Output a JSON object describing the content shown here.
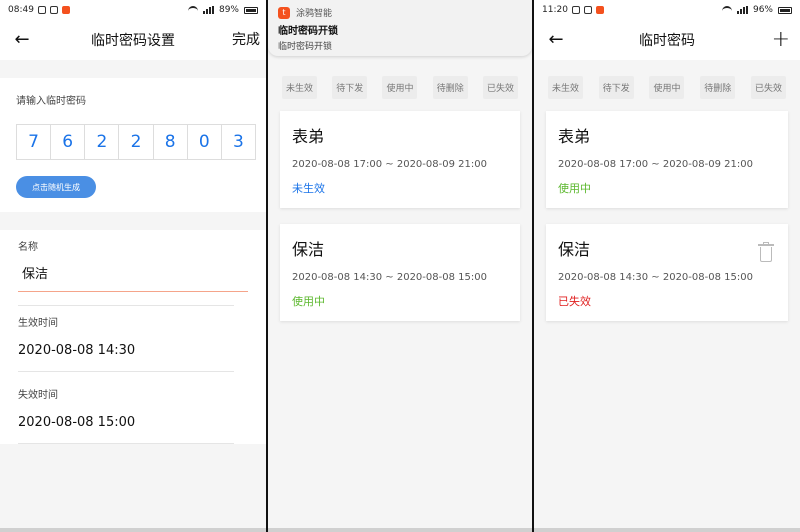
{
  "screen1": {
    "status": {
      "time": "08:49",
      "battery": "89%"
    },
    "nav": {
      "back_icon": "arrow-left-icon",
      "title": "临时密码设置",
      "done": "完成"
    },
    "password_label": "请输入临时密码",
    "digits": [
      "7",
      "6",
      "2",
      "2",
      "8",
      "0",
      "3"
    ],
    "generate_button": "点击随机生成",
    "name_label": "名称",
    "name_value": "保洁",
    "start_label": "生效时间",
    "start_value": "2020-08-08 14:30",
    "end_label": "失效时间",
    "end_value": "2020-08-08 15:00"
  },
  "screen2": {
    "notification": {
      "app_name": "涂鸦智能",
      "title": "临时密码开锁",
      "body": "临时密码开锁"
    },
    "tabs": [
      "未生效",
      "待下发",
      "使用中",
      "待删除",
      "已失效"
    ],
    "cards": [
      {
        "name": "表弟",
        "time": "2020-08-08 17:00 ~ 2020-08-09 21:00",
        "status": "未生效",
        "status_color": "#1a73e8"
      },
      {
        "name": "保洁",
        "time": "2020-08-08 14:30 ~ 2020-08-08 15:00",
        "status": "使用中",
        "status_color": "#5cb82e"
      }
    ]
  },
  "screen3": {
    "status": {
      "time": "11:20",
      "battery": "96%"
    },
    "nav": {
      "back_icon": "arrow-left-icon",
      "title": "临时密码",
      "add_icon": "plus-icon"
    },
    "tabs": [
      "未生效",
      "待下发",
      "使用中",
      "待删除",
      "已失效"
    ],
    "cards": [
      {
        "name": "表弟",
        "time": "2020-08-08 17:00 ~ 2020-08-09 21:00",
        "status": "使用中",
        "status_color": "#5cb82e"
      },
      {
        "name": "保洁",
        "time": "2020-08-08 14:30 ~ 2020-08-08 15:00",
        "status": "已失效",
        "status_color": "#e02020",
        "trash_icon": "trash-icon"
      }
    ]
  }
}
